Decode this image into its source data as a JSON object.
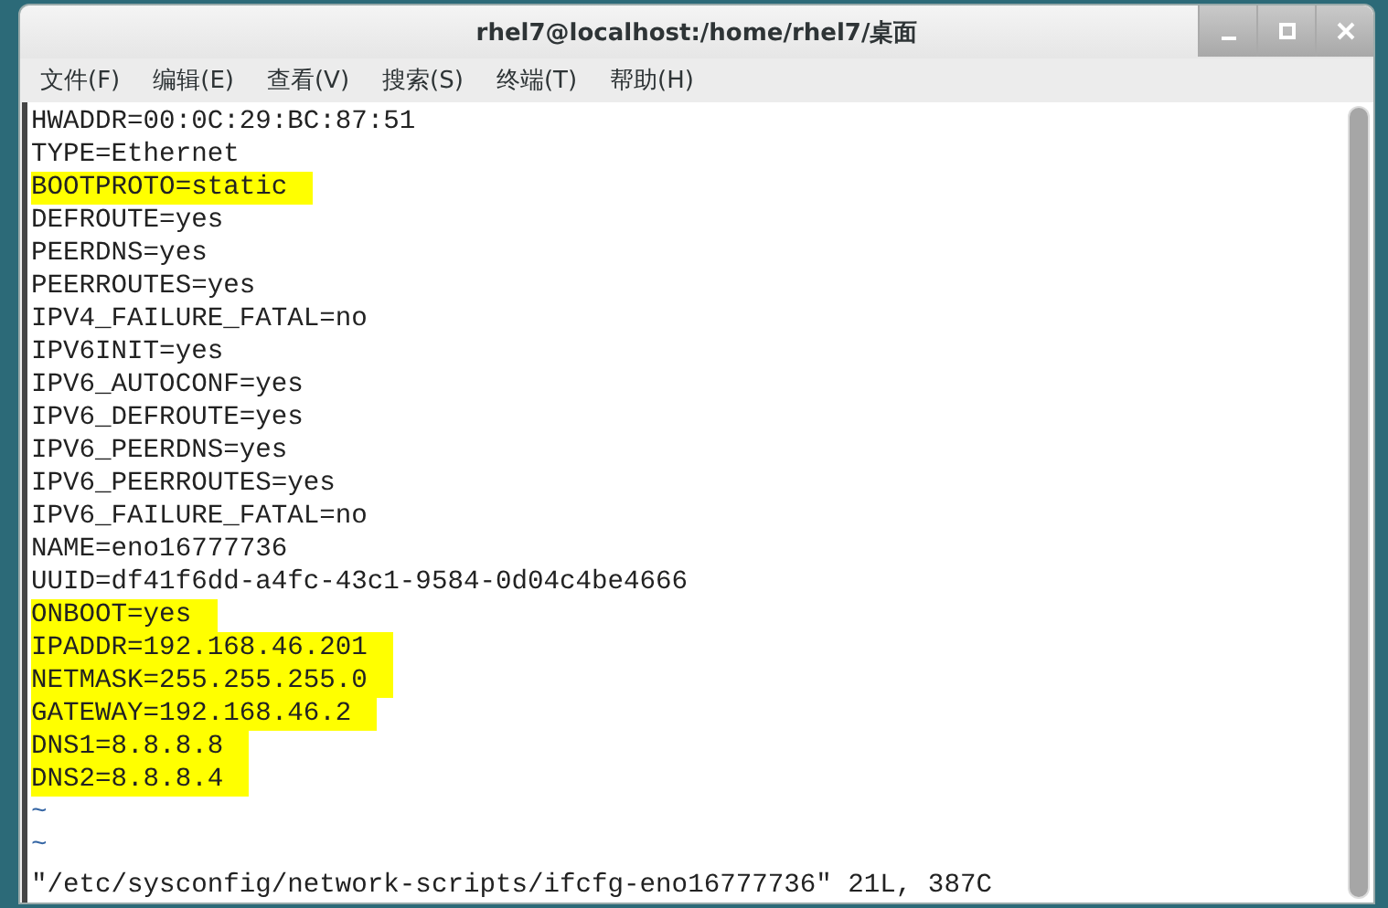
{
  "window": {
    "title": "rhel7@localhost:/home/rhel7/桌面"
  },
  "menu": [
    "文件(F)",
    "编辑(E)",
    "查看(V)",
    "搜索(S)",
    "终端(T)",
    "帮助(H)"
  ],
  "lines": [
    {
      "kind": "text",
      "text": "HWADDR=00:0C:29:BC:87:51",
      "highlighted": false
    },
    {
      "kind": "text",
      "text": "TYPE=Ethernet",
      "highlighted": false
    },
    {
      "kind": "text",
      "text": "BOOTPROTO=static",
      "highlighted": true
    },
    {
      "kind": "text",
      "text": "DEFROUTE=yes",
      "highlighted": false
    },
    {
      "kind": "text",
      "text": "PEERDNS=yes",
      "highlighted": false
    },
    {
      "kind": "text",
      "text": "PEERROUTES=yes",
      "highlighted": false
    },
    {
      "kind": "text",
      "text": "IPV4_FAILURE_FATAL=no",
      "highlighted": false
    },
    {
      "kind": "text",
      "text": "IPV6INIT=yes",
      "highlighted": false
    },
    {
      "kind": "text",
      "text": "IPV6_AUTOCONF=yes",
      "highlighted": false
    },
    {
      "kind": "text",
      "text": "IPV6_DEFROUTE=yes",
      "highlighted": false
    },
    {
      "kind": "text",
      "text": "IPV6_PEERDNS=yes",
      "highlighted": false
    },
    {
      "kind": "text",
      "text": "IPV6_PEERROUTES=yes",
      "highlighted": false
    },
    {
      "kind": "text",
      "text": "IPV6_FAILURE_FATAL=no",
      "highlighted": false
    },
    {
      "kind": "text",
      "text": "NAME=eno16777736",
      "highlighted": false
    },
    {
      "kind": "text",
      "text": "UUID=df41f6dd-a4fc-43c1-9584-0d04c4be4666",
      "highlighted": false
    },
    {
      "kind": "text",
      "text": "ONBOOT=yes",
      "highlighted": true
    },
    {
      "kind": "text",
      "text": "IPADDR=192.168.46.201",
      "highlighted": true
    },
    {
      "kind": "text",
      "text": "NETMASK=255.255.255.0",
      "highlighted": true
    },
    {
      "kind": "text",
      "text": "GATEWAY=192.168.46.2",
      "highlighted": true
    },
    {
      "kind": "text",
      "text": "DNS1=8.8.8.8",
      "highlighted": true
    },
    {
      "kind": "text",
      "text": "DNS2=8.8.8.4",
      "highlighted": true
    },
    {
      "kind": "filler",
      "text": "~",
      "highlighted": false
    },
    {
      "kind": "filler",
      "text": "~",
      "highlighted": false
    }
  ],
  "status_line": "\"/etc/sysconfig/network-scripts/ifcfg-eno16777736\" 21L, 387C"
}
